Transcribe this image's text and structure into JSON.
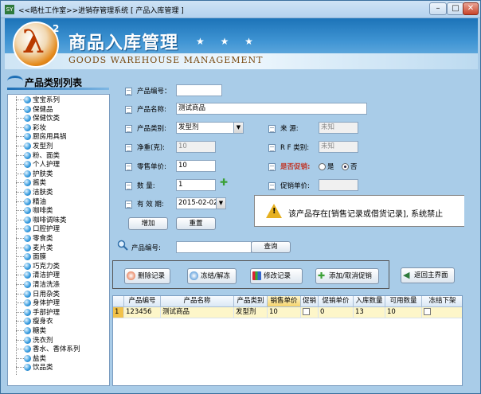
{
  "window": {
    "icon_text": "SY",
    "title": "<<皓杜工作室>>进销存管理系统 [ 产品入库管理 ]",
    "min_label": "–",
    "max_label": "□",
    "close_label": "✕"
  },
  "banner": {
    "logo_glyph": "λ",
    "logo_sup": "2",
    "title": "商品入库管理",
    "stars": "★ ★ ★",
    "subtitle": "GOODS WAREHOUSE MANAGEMENT"
  },
  "sidebar": {
    "title": "产品类别列表",
    "items": [
      "宝宝系列",
      "保健品",
      "保健饮类",
      "彩妆",
      "厨房用具锅",
      "发型剂",
      "粉、面类",
      "个人护理",
      "护肤类",
      "酱类",
      "洁肤类",
      "精油",
      "咖啡类",
      "咖啡调味类",
      "口腔护理",
      "零食类",
      "麦片类",
      "面膜",
      "巧克力类",
      "清洁护理",
      "清洁洗涤",
      "日用杂类",
      "身体护理",
      "手部护理",
      "瘦身衣",
      "糖类",
      "洗衣剂",
      "香水、香体系列",
      "盐类",
      "饮品类"
    ]
  },
  "form": {
    "product_no_label": "产品编号：",
    "product_no_value": "",
    "product_name_label": "产品名称:",
    "product_name_value": "测试商品",
    "category_label": "产品类别:",
    "category_value": "发型剂",
    "source_label": "来    源:",
    "source_value": "未知",
    "net_weight_label": "净重(克):",
    "net_weight_value": "10",
    "rf_label": "R F 类别:",
    "rf_value": "未知",
    "price_label": "零售单价:",
    "price_value": "10",
    "promo_label": "是否促销:",
    "promo_yes": "是",
    "promo_no": "否",
    "qty_label": "数    量:",
    "qty_value": "1",
    "promo_price_label": "促销单价:",
    "promo_price_value": "",
    "expiry_label": "有 效 期:",
    "expiry_value": "2015-02-02",
    "add_button": "增加",
    "reset_button": "重置"
  },
  "warning": {
    "text": "该产品存在[销售记录或借货记录], 系统禁止"
  },
  "search": {
    "label": "产品编号:",
    "value": "",
    "button": "查询"
  },
  "actions": {
    "delete": "删除记录",
    "freeze": "冻结/解冻",
    "edit": "修改记录",
    "promo": "添加/取消促销",
    "home": "返回主界面"
  },
  "table": {
    "columns": [
      "",
      "产品编号",
      "产品名称",
      "产品类别",
      "销售单价",
      "促销",
      "促销单价",
      "入库数量",
      "可用数量",
      "冻结下架"
    ],
    "rows": [
      {
        "idx": "1",
        "no": "123456",
        "name": "测试商品",
        "category": "发型剂",
        "price": "10",
        "promo": "",
        "promo_price": "0",
        "in_qty": "13",
        "avail_qty": "10",
        "frozen": ""
      }
    ]
  },
  "colors": {
    "banner_blue": "#1c73b8",
    "window_bg": "#a9cce8",
    "row_highlight": "#fdf6c9",
    "warn_yellow": "#e6b020"
  }
}
